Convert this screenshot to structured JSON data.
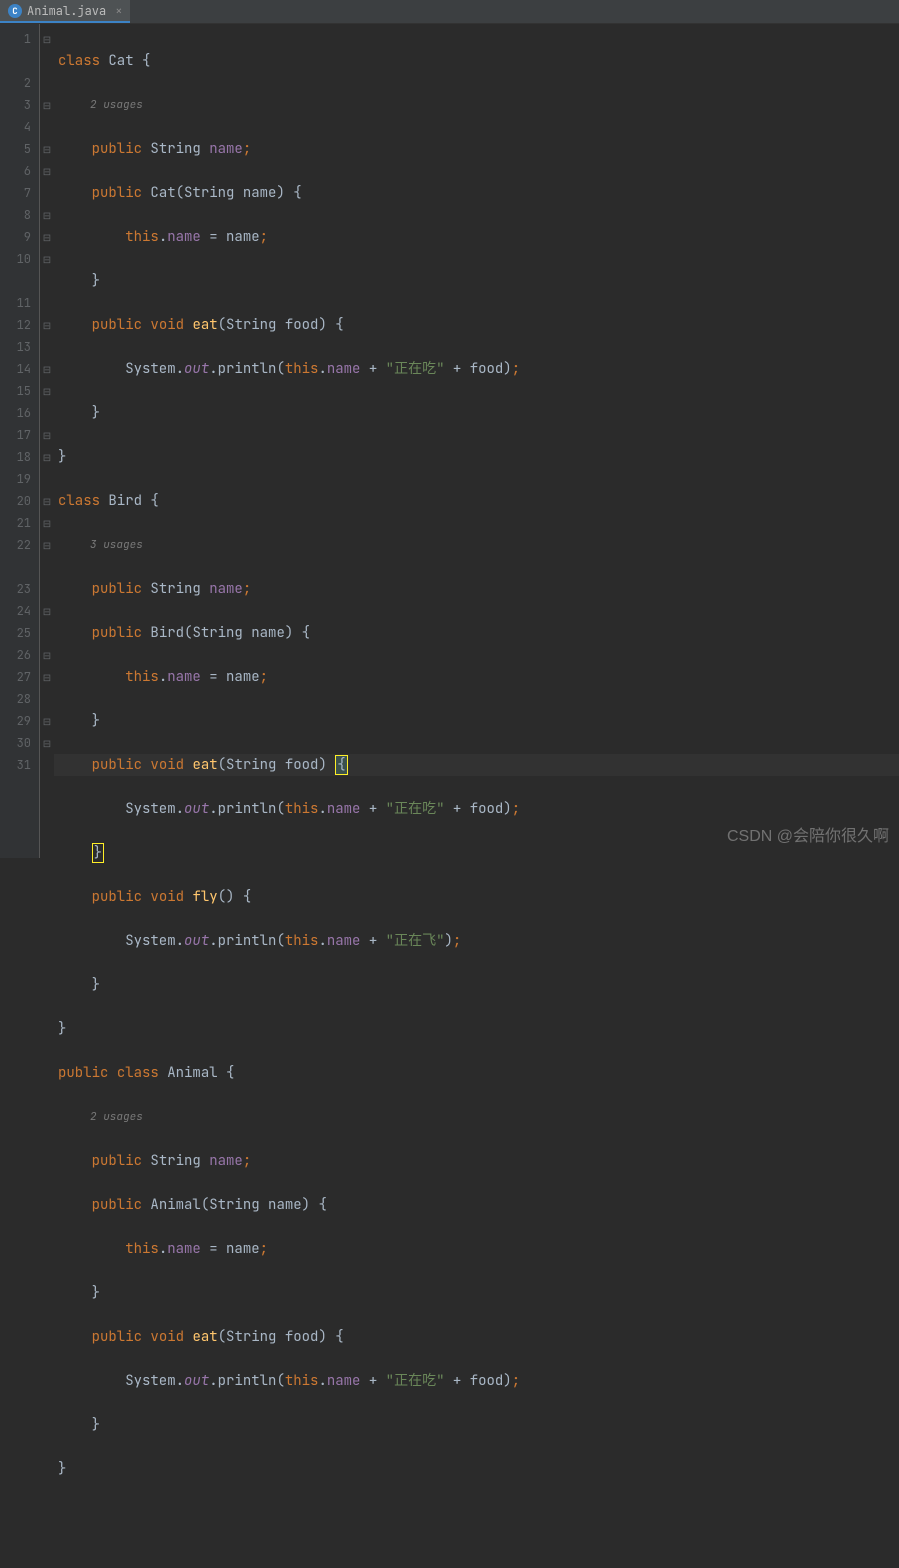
{
  "tab": {
    "filename": "Animal.java",
    "icon_letter": "C"
  },
  "watermark": "CSDN @会陪你很久啊",
  "usages": {
    "cat": "2 usages",
    "bird": "3 usages",
    "animal": "2 usages"
  },
  "code": {
    "l1": {
      "kw1": "class",
      "cls": "Cat",
      "br": "{"
    },
    "l2": {
      "kw": "public",
      "type": "String",
      "name": "name",
      "semi": ";"
    },
    "l3": {
      "kw": "public",
      "ctor": "Cat",
      "lp": "(",
      "ptype": "String",
      "pname": "name",
      "rp": ")",
      "br": "{"
    },
    "l4": {
      "this": "this",
      "dot": ".",
      "fld": "name",
      "eq": " = ",
      "var": "name",
      "semi": ";"
    },
    "l5": {
      "br": "}"
    },
    "l6": {
      "kw": "public",
      "ret": "void",
      "fn": "eat",
      "lp": "(",
      "ptype": "String",
      "pname": "food",
      "rp": ")",
      "br": "{"
    },
    "l7": {
      "sys": "System",
      "d1": ".",
      "out": "out",
      "d2": ".",
      "pr": "println",
      "lp": "(",
      "this": "this",
      "d3": ".",
      "fld": "name",
      "plus1": " + ",
      "str": "\"正在吃\"",
      "plus2": " + ",
      "var": "food",
      "rp": ")",
      "semi": ";"
    },
    "l8": {
      "br": "}"
    },
    "l9": {
      "br": "}"
    },
    "l10": {
      "kw1": "class",
      "cls": "Bird",
      "br": "{"
    },
    "l11": {
      "kw": "public",
      "type": "String",
      "name": "name",
      "semi": ";"
    },
    "l12": {
      "kw": "public",
      "ctor": "Bird",
      "lp": "(",
      "ptype": "String",
      "pname": "name",
      "rp": ")",
      "br": "{"
    },
    "l13": {
      "this": "this",
      "dot": ".",
      "fld": "name",
      "eq": " = ",
      "var": "name",
      "semi": ";"
    },
    "l14": {
      "br": "}"
    },
    "l15": {
      "kw": "public",
      "ret": "void",
      "fn": "eat",
      "lp": "(",
      "ptype": "String",
      "pname": "food",
      "rp": ")",
      "br": "{"
    },
    "l16": {
      "sys": "System",
      "d1": ".",
      "out": "out",
      "d2": ".",
      "pr": "println",
      "lp": "(",
      "this": "this",
      "d3": ".",
      "fld": "name",
      "plus1": " + ",
      "str": "\"正在吃\"",
      "plus2": " + ",
      "var": "food",
      "rp": ")",
      "semi": ";"
    },
    "l17": {
      "br": "}"
    },
    "l18": {
      "kw": "public",
      "ret": "void",
      "fn": "fly",
      "lp": "(",
      "rp": ")",
      "br": "{"
    },
    "l19": {
      "sys": "System",
      "d1": ".",
      "out": "out",
      "d2": ".",
      "pr": "println",
      "lp": "(",
      "this": "this",
      "d3": ".",
      "fld": "name",
      "plus1": " + ",
      "str": "\"正在飞\"",
      "rp": ")",
      "semi": ";"
    },
    "l20": {
      "br": "}"
    },
    "l21": {
      "br": "}"
    },
    "l22": {
      "kw1": "public",
      "kw2": "class",
      "cls": "Animal",
      "br": "{"
    },
    "l23": {
      "kw": "public",
      "type": "String",
      "name": "name",
      "semi": ";"
    },
    "l24": {
      "kw": "public",
      "ctor": "Animal",
      "lp": "(",
      "ptype": "String",
      "pname": "name",
      "rp": ")",
      "br": "{"
    },
    "l25": {
      "this": "this",
      "dot": ".",
      "fld": "name",
      "eq": " = ",
      "var": "name",
      "semi": ";"
    },
    "l26": {
      "br": "}"
    },
    "l27": {
      "kw": "public",
      "ret": "void",
      "fn": "eat",
      "lp": "(",
      "ptype": "String",
      "pname": "food",
      "rp": ")",
      "br": "{"
    },
    "l28": {
      "sys": "System",
      "d1": ".",
      "out": "out",
      "d2": ".",
      "pr": "println",
      "lp": "(",
      "this": "this",
      "d3": ".",
      "fld": "name",
      "plus1": " + ",
      "str": "\"正在吃\"",
      "plus2": " + ",
      "var": "food",
      "rp": ")",
      "semi": ";"
    },
    "l29": {
      "br": "}"
    },
    "l30": {
      "br": "}"
    }
  },
  "line_numbers": [
    "1",
    "2",
    "3",
    "4",
    "5",
    "6",
    "7",
    "8",
    "9",
    "10",
    "11",
    "12",
    "13",
    "14",
    "15",
    "16",
    "17",
    "18",
    "19",
    "20",
    "21",
    "22",
    "23",
    "24",
    "25",
    "26",
    "27",
    "28",
    "29",
    "30",
    "31"
  ]
}
